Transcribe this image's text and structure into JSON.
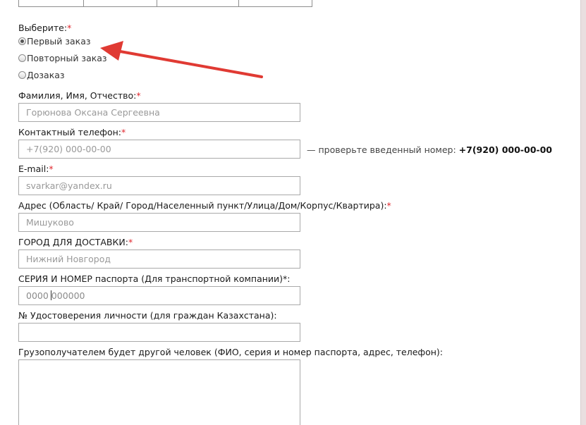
{
  "form": {
    "choose": {
      "label": "Выберите:",
      "required_mark": "*",
      "options": [
        {
          "label": "Первый заказ",
          "checked": true
        },
        {
          "label": "Повторный заказ",
          "checked": false
        },
        {
          "label": "Дозаказ",
          "checked": false
        }
      ]
    },
    "full_name": {
      "label": "Фамилия, Имя, Отчество:",
      "required_mark": "*",
      "placeholder": "Горюнова Оксана Сергеевна"
    },
    "phone": {
      "label": "Контактный телефон:",
      "required_mark": "*",
      "placeholder": "+7(920) 000-00-00",
      "hint_prefix": "— проверьте введенный номер: ",
      "hint_number": "+7(920) 000-00-00"
    },
    "email": {
      "label": "E-mail:",
      "required_mark": "*",
      "placeholder": "svarkar@yandex.ru"
    },
    "address": {
      "label": "Адрес (Область/ Край/ Город/Населенный пункт/Улица/Дом/Корпус/Квартира):",
      "required_mark": "*",
      "placeholder": "Мишуково"
    },
    "city": {
      "label": "ГОРОД ДЛЯ ДОСТАВКИ:",
      "required_mark": "*",
      "placeholder": "Нижний Новгород"
    },
    "passport": {
      "label": "СЕРИЯ И НОМЕР паспорта (Для транспортной компании)*:",
      "value_before_caret": "0000 ",
      "value_after_caret": "000000"
    },
    "kz_id": {
      "label": "№ Удостоверения личности (для граждан Казахстана):",
      "value": ""
    },
    "recipient": {
      "label": "Грузополучателем будет другой человек (ФИО, серия и номер паспорта, адрес, телефон):",
      "value": ""
    }
  },
  "colors": {
    "required": "#e0282e",
    "annotation_arrow": "#e03a33",
    "background": "#e9dfe0"
  }
}
